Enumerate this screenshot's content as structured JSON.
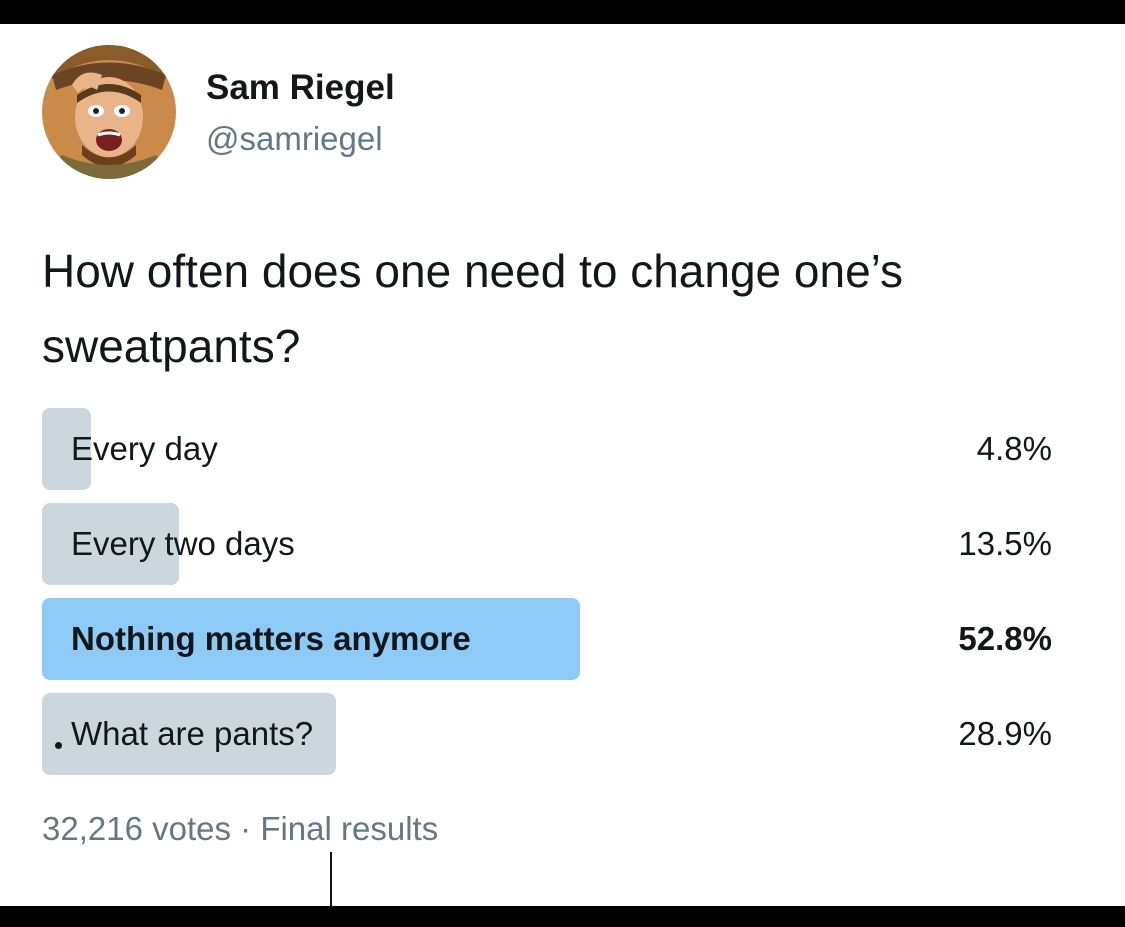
{
  "tweet": {
    "author_name": "Sam Riegel",
    "author_handle": "@samriegel",
    "question": "How often does one need to change one’s sweatpants?"
  },
  "poll": {
    "options": [
      {
        "label": "Every day",
        "percent_text": "4.8%",
        "percent": 4.8
      },
      {
        "label": "Every two days",
        "percent_text": "13.5%",
        "percent": 13.5
      },
      {
        "label": "Nothing matters anymore",
        "percent_text": "52.8%",
        "percent": 52.8
      },
      {
        "label": "What are pants?",
        "percent_text": "28.9%",
        "percent": 28.9
      }
    ],
    "winner_index": 2,
    "votes_text": "32,216 votes",
    "separator": " · ",
    "status_text": "Final results"
  },
  "colors": {
    "bar": "#ccd6dd",
    "winner_bar": "#8ecaf6",
    "text": "#14171a",
    "secondary_text": "#657786"
  }
}
